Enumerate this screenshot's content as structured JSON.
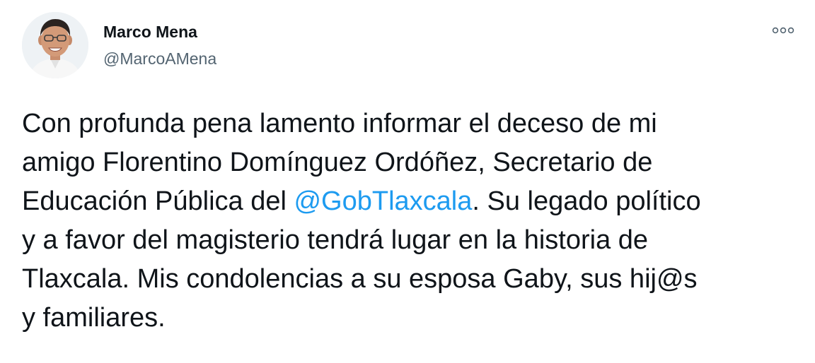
{
  "author": {
    "name": "Marco Mena",
    "handle": "@MarcoAMena",
    "avatar_icon": "profile-photo"
  },
  "more_menu": {
    "icon": "more-horizontal-icon"
  },
  "tweet": {
    "line1": "Con profunda pena lamento informar el deceso de mi",
    "line2": "amigo Florentino Domínguez Ordóñez, Secretario de",
    "line3_pre": "Educación Pública del ",
    "mention": "@GobTlaxcala",
    "line3_post": ". Su legado político",
    "line4": "y a favor del magisterio tendrá lugar en la historia de",
    "line5": "Tlaxcala. Mis condolencias a su esposa Gaby, sus hij@s",
    "line6": "y familiares."
  },
  "colors": {
    "text": "#0f1419",
    "secondary": "#536471",
    "link": "#1d9bf0",
    "background": "#ffffff"
  }
}
